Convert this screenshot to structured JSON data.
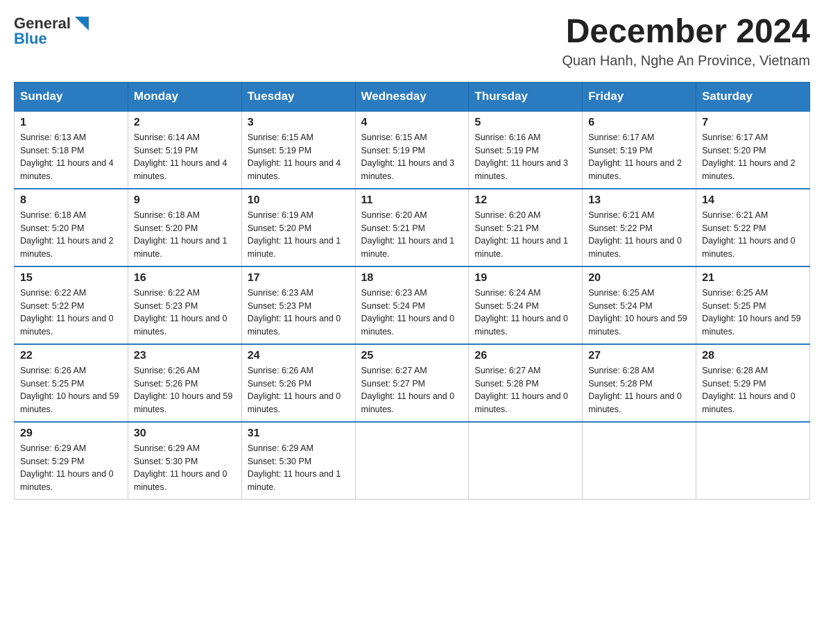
{
  "header": {
    "logo_text_general": "General",
    "logo_text_blue": "Blue",
    "month_title": "December 2024",
    "location": "Quan Hanh, Nghe An Province, Vietnam"
  },
  "days_of_week": [
    "Sunday",
    "Monday",
    "Tuesday",
    "Wednesday",
    "Thursday",
    "Friday",
    "Saturday"
  ],
  "weeks": [
    [
      {
        "day": "1",
        "sunrise": "6:13 AM",
        "sunset": "5:18 PM",
        "daylight": "11 hours and 4 minutes."
      },
      {
        "day": "2",
        "sunrise": "6:14 AM",
        "sunset": "5:19 PM",
        "daylight": "11 hours and 4 minutes."
      },
      {
        "day": "3",
        "sunrise": "6:15 AM",
        "sunset": "5:19 PM",
        "daylight": "11 hours and 4 minutes."
      },
      {
        "day": "4",
        "sunrise": "6:15 AM",
        "sunset": "5:19 PM",
        "daylight": "11 hours and 3 minutes."
      },
      {
        "day": "5",
        "sunrise": "6:16 AM",
        "sunset": "5:19 PM",
        "daylight": "11 hours and 3 minutes."
      },
      {
        "day": "6",
        "sunrise": "6:17 AM",
        "sunset": "5:19 PM",
        "daylight": "11 hours and 2 minutes."
      },
      {
        "day": "7",
        "sunrise": "6:17 AM",
        "sunset": "5:20 PM",
        "daylight": "11 hours and 2 minutes."
      }
    ],
    [
      {
        "day": "8",
        "sunrise": "6:18 AM",
        "sunset": "5:20 PM",
        "daylight": "11 hours and 2 minutes."
      },
      {
        "day": "9",
        "sunrise": "6:18 AM",
        "sunset": "5:20 PM",
        "daylight": "11 hours and 1 minute."
      },
      {
        "day": "10",
        "sunrise": "6:19 AM",
        "sunset": "5:20 PM",
        "daylight": "11 hours and 1 minute."
      },
      {
        "day": "11",
        "sunrise": "6:20 AM",
        "sunset": "5:21 PM",
        "daylight": "11 hours and 1 minute."
      },
      {
        "day": "12",
        "sunrise": "6:20 AM",
        "sunset": "5:21 PM",
        "daylight": "11 hours and 1 minute."
      },
      {
        "day": "13",
        "sunrise": "6:21 AM",
        "sunset": "5:22 PM",
        "daylight": "11 hours and 0 minutes."
      },
      {
        "day": "14",
        "sunrise": "6:21 AM",
        "sunset": "5:22 PM",
        "daylight": "11 hours and 0 minutes."
      }
    ],
    [
      {
        "day": "15",
        "sunrise": "6:22 AM",
        "sunset": "5:22 PM",
        "daylight": "11 hours and 0 minutes."
      },
      {
        "day": "16",
        "sunrise": "6:22 AM",
        "sunset": "5:23 PM",
        "daylight": "11 hours and 0 minutes."
      },
      {
        "day": "17",
        "sunrise": "6:23 AM",
        "sunset": "5:23 PM",
        "daylight": "11 hours and 0 minutes."
      },
      {
        "day": "18",
        "sunrise": "6:23 AM",
        "sunset": "5:24 PM",
        "daylight": "11 hours and 0 minutes."
      },
      {
        "day": "19",
        "sunrise": "6:24 AM",
        "sunset": "5:24 PM",
        "daylight": "11 hours and 0 minutes."
      },
      {
        "day": "20",
        "sunrise": "6:25 AM",
        "sunset": "5:24 PM",
        "daylight": "10 hours and 59 minutes."
      },
      {
        "day": "21",
        "sunrise": "6:25 AM",
        "sunset": "5:25 PM",
        "daylight": "10 hours and 59 minutes."
      }
    ],
    [
      {
        "day": "22",
        "sunrise": "6:26 AM",
        "sunset": "5:25 PM",
        "daylight": "10 hours and 59 minutes."
      },
      {
        "day": "23",
        "sunrise": "6:26 AM",
        "sunset": "5:26 PM",
        "daylight": "10 hours and 59 minutes."
      },
      {
        "day": "24",
        "sunrise": "6:26 AM",
        "sunset": "5:26 PM",
        "daylight": "11 hours and 0 minutes."
      },
      {
        "day": "25",
        "sunrise": "6:27 AM",
        "sunset": "5:27 PM",
        "daylight": "11 hours and 0 minutes."
      },
      {
        "day": "26",
        "sunrise": "6:27 AM",
        "sunset": "5:28 PM",
        "daylight": "11 hours and 0 minutes."
      },
      {
        "day": "27",
        "sunrise": "6:28 AM",
        "sunset": "5:28 PM",
        "daylight": "11 hours and 0 minutes."
      },
      {
        "day": "28",
        "sunrise": "6:28 AM",
        "sunset": "5:29 PM",
        "daylight": "11 hours and 0 minutes."
      }
    ],
    [
      {
        "day": "29",
        "sunrise": "6:29 AM",
        "sunset": "5:29 PM",
        "daylight": "11 hours and 0 minutes."
      },
      {
        "day": "30",
        "sunrise": "6:29 AM",
        "sunset": "5:30 PM",
        "daylight": "11 hours and 0 minutes."
      },
      {
        "day": "31",
        "sunrise": "6:29 AM",
        "sunset": "5:30 PM",
        "daylight": "11 hours and 1 minute."
      },
      null,
      null,
      null,
      null
    ]
  ]
}
